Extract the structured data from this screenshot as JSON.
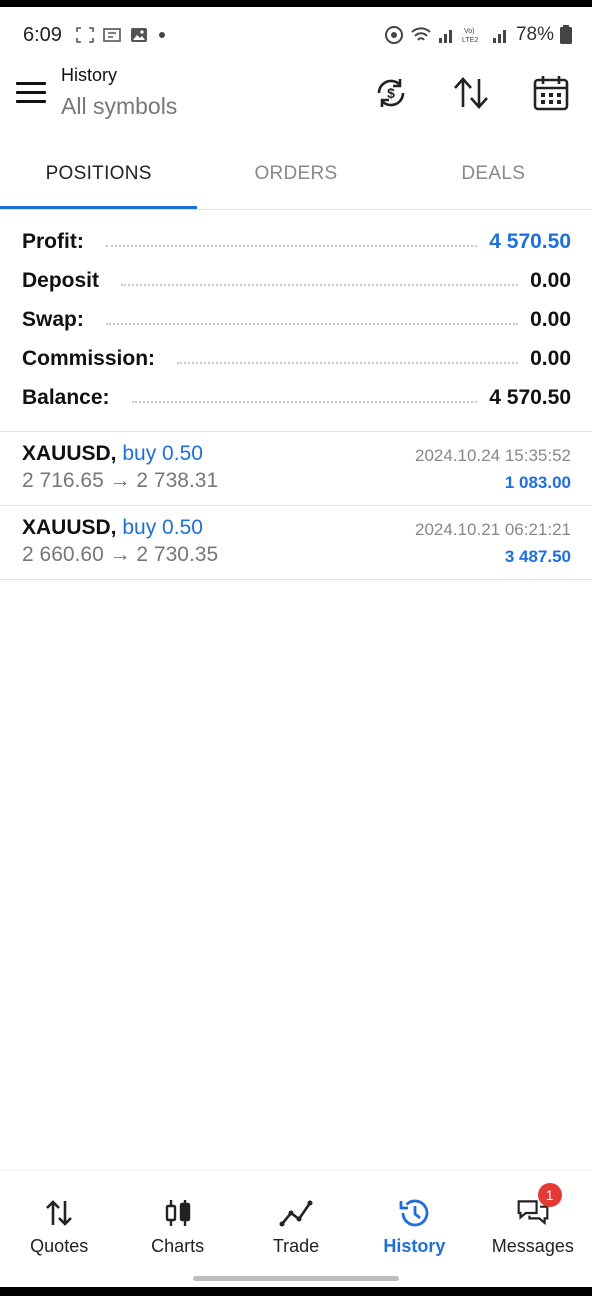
{
  "status_bar": {
    "time": "6:09",
    "battery": "78%"
  },
  "header": {
    "title": "History",
    "subtitle": "All symbols"
  },
  "tabs": [
    {
      "label": "POSITIONS",
      "active": true
    },
    {
      "label": "ORDERS",
      "active": false
    },
    {
      "label": "DEALS",
      "active": false
    }
  ],
  "summary": {
    "profit": {
      "label": "Profit:",
      "value": "4 570.50"
    },
    "deposit": {
      "label": "Deposit",
      "value": "0.00"
    },
    "swap": {
      "label": "Swap:",
      "value": "0.00"
    },
    "commission": {
      "label": "Commission:",
      "value": "0.00"
    },
    "balance": {
      "label": "Balance:",
      "value": "4 570.50"
    }
  },
  "deals": [
    {
      "symbol": "XAUUSD,",
      "side": "buy 0.50",
      "prices": "2 716.65 → 2 738.31",
      "date": "2024.10.24 15:35:52",
      "profit": "1 083.00"
    },
    {
      "symbol": "XAUUSD,",
      "side": "buy 0.50",
      "prices": "2 660.60 → 2 730.35",
      "date": "2024.10.21 06:21:21",
      "profit": "3 487.50"
    }
  ],
  "bottom_nav": [
    {
      "label": "Quotes",
      "icon": "quotes-icon"
    },
    {
      "label": "Charts",
      "icon": "charts-icon"
    },
    {
      "label": "Trade",
      "icon": "trade-icon"
    },
    {
      "label": "History",
      "icon": "history-icon",
      "active": true
    },
    {
      "label": "Messages",
      "icon": "messages-icon",
      "badge": "1"
    }
  ],
  "colors": {
    "accent": "#1e6fd9",
    "badge": "#e53935"
  }
}
